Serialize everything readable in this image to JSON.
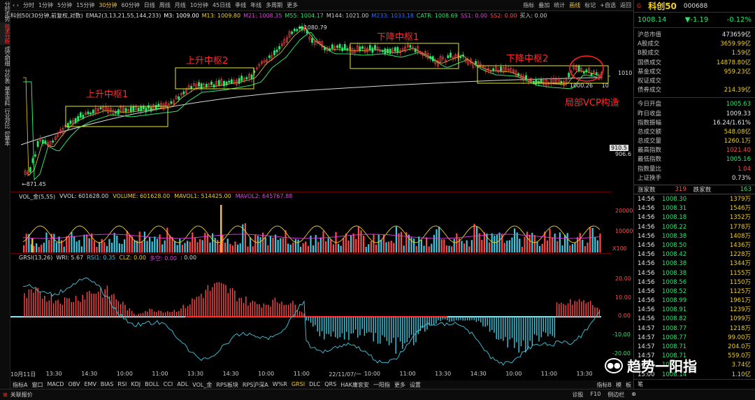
{
  "colors": {
    "up": "#ff4a4a",
    "down": "#2ce66a",
    "accent": "#f0c030",
    "zs_box": "#e6e630"
  },
  "sidetabs": [
    "分时走势",
    "技术分析",
    "成交明细",
    "分价表",
    "基本资料",
    "行业对比",
    "控基本"
  ],
  "topbar": {
    "periods": [
      "分时",
      "1分钟",
      "5分钟",
      "15分钟",
      "30分钟",
      "60分钟",
      "日线",
      "周线",
      "月线",
      "10分钟",
      "45日线",
      "季线",
      "年线",
      "多周期",
      "更多"
    ],
    "active_period": "30分钟",
    "right_tools": [
      "指标",
      "叠加",
      "统计",
      "画线",
      "标记",
      "+自选",
      "返回"
    ],
    "chevron": "‹ ›"
  },
  "indicator_bar": [
    {
      "text": "科创50(30分钟,前复权,对数)",
      "color": "#dddddd"
    },
    {
      "text": "EMA2(3,13,21,55,144,233)",
      "color": "#dddddd"
    },
    {
      "text": "M3: 1009.00",
      "color": "#ffffff"
    },
    {
      "text": "M13: 1009.80",
      "color": "#f0d020"
    },
    {
      "text": "M21: 1008.35",
      "color": "#e040e0"
    },
    {
      "text": "M55: 1004.17",
      "color": "#2ce66a"
    },
    {
      "text": "M144: 1021.00",
      "color": "#cccccc"
    },
    {
      "text": "M233: 1033.18",
      "color": "#3070ff"
    },
    {
      "text": "CATR: 1008.69",
      "color": "#2ce66a"
    },
    {
      "text": "SS1: 0.00",
      "color": "#e040e0"
    },
    {
      "text": "SS2: 0.00",
      "color": "#ff4a4a"
    },
    {
      "text": "买入: 0.00",
      "color": "#cccccc"
    }
  ],
  "main_chart": {
    "annotations": [
      {
        "label": "上升中枢1"
      },
      {
        "label": "上升中枢2"
      },
      {
        "label": "下降中枢1"
      },
      {
        "label": "下降中枢2"
      },
      {
        "label": "局部VCP构造"
      }
    ],
    "high_label": "1080.79",
    "low_label": "871.45",
    "last_label": "1000.26",
    "last_label_suffix": "10",
    "price_axis": [
      "1010",
      "910.5",
      "906.6"
    ]
  },
  "volume_panel": {
    "title": "VOL_金(5,55)",
    "vvol": "VVOL: 601628.00",
    "volume": "VOLUME: 601628.00",
    "mavol1": "MAVOL1: 514425.00",
    "mavol2": "MAVOL2: 645767.88",
    "axis": [
      "20000",
      "10000"
    ],
    "unit": "X100"
  },
  "grsi_panel": {
    "title": "GRSI(13,26)",
    "wri": "WRI: 5.67",
    "rsi1": "RSI1: 0.35",
    "clz": "CLZ: 0.00",
    "duokong": "多空: 0.00",
    "tail": ": 0.00",
    "axis": [
      "20.00",
      "10.00",
      "0.00",
      "-10.00",
      "-20.00"
    ]
  },
  "time_axis": [
    "10月11日",
    "13:30",
    "14:30",
    "10:00",
    "11:00",
    "13:30",
    "14:30",
    "10:00",
    "11:00",
    "22/11/07/一 10:00",
    "10:00",
    "11:00",
    "13:30",
    "14:30",
    "10:00",
    "11:00",
    "13:30"
  ],
  "bottom_tabs": [
    "指标A",
    "窗口",
    "MACD",
    "OBV",
    "EMV",
    "BIAS",
    "RSI",
    "KDJ",
    "BOLL",
    "CCI",
    "ADL",
    "VOL_金",
    "RPS板块",
    "RPS沪深A",
    "W%R",
    "GRSI",
    "DLC",
    "QRS",
    "HAK庸衮安",
    "一阳指",
    "更多",
    "设置"
  ],
  "bottom_right": [
    "指标B",
    "模",
    "板"
  ],
  "statusbar": {
    "left": "关联报价",
    "right": [
      "诊股",
      "F10",
      "侧边栏",
      "⊕"
    ]
  },
  "right_panel": {
    "flag": "G",
    "name": "科创50",
    "code": "000688",
    "price": "1008.14",
    "change": "▼-1.19",
    "pct": "-0.12%",
    "stats": [
      {
        "label": "沪总市值",
        "value": "473659亿",
        "color": "white"
      },
      {
        "label": "A股成交",
        "value": "3659.99亿",
        "color": "yellow"
      },
      {
        "label": "B股成交",
        "value": "1.59亿",
        "color": "yellow"
      },
      {
        "label": "国债成交",
        "value": "14878.80亿",
        "color": "yellow"
      },
      {
        "label": "基金成交",
        "value": "959.23亿",
        "color": "yellow"
      },
      {
        "label": "权证成交",
        "value": "",
        "color": "yellow"
      },
      {
        "label": "债券成交",
        "value": "214.39亿",
        "color": "yellow"
      },
      {
        "label": "今日开盘",
        "value": "1005.63",
        "color": "green"
      },
      {
        "label": "昨日收盘",
        "value": "1009.33",
        "color": "white"
      },
      {
        "label": "指数振幅",
        "value": "16.24/1.61%",
        "color": "white"
      },
      {
        "label": "总成交额",
        "value": "548.08亿",
        "color": "yellow"
      },
      {
        "label": "总成交量",
        "value": "1260.1万",
        "color": "yellow"
      },
      {
        "label": "最高指数",
        "value": "1021.40",
        "color": "red"
      },
      {
        "label": "最低指数",
        "value": "1005.16",
        "color": "green"
      },
      {
        "label": "指数量比",
        "value": "1.04",
        "color": "red"
      },
      {
        "label": "上证换手",
        "value": "0.73%",
        "color": "white"
      }
    ],
    "updown": {
      "up_label": "涨家数",
      "up": "319",
      "down_label": "跌家数",
      "down": "163"
    },
    "ticks": [
      {
        "time": "14:56",
        "price": "1008.30",
        "vol": "1379万"
      },
      {
        "time": "14:56",
        "price": "1008.31",
        "vol": "1546万"
      },
      {
        "time": "14:56",
        "price": "1008.18",
        "vol": "1352万"
      },
      {
        "time": "14:56",
        "price": "1008.22",
        "vol": "1778万"
      },
      {
        "time": "14:56",
        "price": "1008.38",
        "vol": "1408万"
      },
      {
        "time": "14:56",
        "price": "1008.50",
        "vol": "1436万"
      },
      {
        "time": "14:56",
        "price": "1008.42",
        "vol": "1228万"
      },
      {
        "time": "14:56",
        "price": "1008.38",
        "vol": "1344万"
      },
      {
        "time": "14:56",
        "price": "1008.38",
        "vol": "1155万"
      },
      {
        "time": "14:56",
        "price": "1008.56",
        "vol": "1150万"
      },
      {
        "time": "14:56",
        "price": "1008.52",
        "vol": "1125万"
      },
      {
        "time": "14:56",
        "price": "1008.99",
        "vol": "1961万"
      },
      {
        "time": "14:56",
        "price": "1008.91",
        "vol": "1239万"
      },
      {
        "time": "14:56",
        "price": "1008.82",
        "vol": "1099万"
      },
      {
        "time": "14:57",
        "price": "1008.77",
        "vol": "1218万"
      },
      {
        "time": "14:57",
        "price": "1008.77",
        "vol": "99.00万"
      },
      {
        "time": "14:57",
        "price": "1008.71",
        "vol": "204.0万"
      },
      {
        "time": "14:57",
        "price": "1008.71",
        "vol": "559.0万"
      },
      {
        "time": "14:57",
        "price": "1008.71",
        "vol": "3.74亿"
      },
      {
        "time": "15:00",
        "price": "1008.14",
        "vol": "1.10亿"
      }
    ],
    "bottom": "笔"
  },
  "watermark": "趋势一阳指"
}
